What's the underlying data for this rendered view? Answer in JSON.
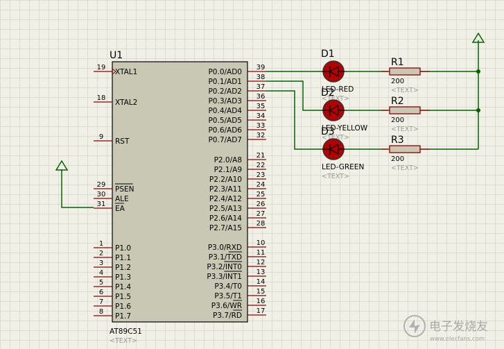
{
  "colors": {
    "background": "#f0f0e6",
    "grid": "#c9c9bd",
    "chip_fill": "#c8c8b4",
    "outline": "#000000",
    "pin_line": "#8b0000",
    "wire": "#006400",
    "led_fill": "#b40000",
    "resistor_fill": "#c8c8b4"
  },
  "chip": {
    "ref": "U1",
    "part": "AT89C51",
    "text_placeholder": "<TEXT>",
    "left_pins": [
      {
        "num": "19",
        "label": "XTAL1",
        "clock": true
      },
      {
        "num": "18",
        "label": "XTAL2"
      },
      {
        "num": "9",
        "label": "RST"
      },
      {
        "num": "29",
        "label": "PSEN",
        "overbar": true
      },
      {
        "num": "30",
        "label": "ALE"
      },
      {
        "num": "31",
        "label": "EA",
        "overbar": true
      },
      {
        "num": "1",
        "label": "P1.0"
      },
      {
        "num": "2",
        "label": "P1.1"
      },
      {
        "num": "3",
        "label": "P1.2"
      },
      {
        "num": "4",
        "label": "P1.3"
      },
      {
        "num": "5",
        "label": "P1.4"
      },
      {
        "num": "6",
        "label": "P1.5"
      },
      {
        "num": "7",
        "label": "P1.6"
      },
      {
        "num": "8",
        "label": "P1.7"
      }
    ],
    "right_pins": [
      {
        "num": "39",
        "label": "P0.0/AD0"
      },
      {
        "num": "38",
        "label": "P0.1/AD1"
      },
      {
        "num": "37",
        "label": "P0.2/AD2"
      },
      {
        "num": "36",
        "label": "P0.3/AD3"
      },
      {
        "num": "35",
        "label": "P0.4/AD4"
      },
      {
        "num": "34",
        "label": "P0.5/AD5"
      },
      {
        "num": "33",
        "label": "P0.6/AD6"
      },
      {
        "num": "32",
        "label": "P0.7/AD7"
      },
      {
        "num": "21",
        "label": "P2.0/A8"
      },
      {
        "num": "22",
        "label": "P2.1/A9"
      },
      {
        "num": "23",
        "label": "P2.2/A10"
      },
      {
        "num": "24",
        "label": "P2.3/A11"
      },
      {
        "num": "25",
        "label": "P2.4/A12"
      },
      {
        "num": "26",
        "label": "P2.5/A13"
      },
      {
        "num": "27",
        "label": "P2.6/A14"
      },
      {
        "num": "28",
        "label": "P2.7/A15"
      },
      {
        "num": "10",
        "label": "P3.0/RXD"
      },
      {
        "num": "11",
        "label": "P3.1/TXD",
        "bar_from": 5
      },
      {
        "num": "12",
        "label": "P3.2/INT0",
        "bar_from": 5
      },
      {
        "num": "13",
        "label": "P3.3/INT1",
        "bar_from": 5
      },
      {
        "num": "14",
        "label": "P3.4/T0"
      },
      {
        "num": "15",
        "label": "P3.5/T1"
      },
      {
        "num": "16",
        "label": "P3.6/WR",
        "bar_from": 5
      },
      {
        "num": "17",
        "label": "P3.7/RD",
        "bar_from": 5
      }
    ]
  },
  "leds": [
    {
      "ref": "D1",
      "name": "LED-RED",
      "placeholder": "<TEXT>"
    },
    {
      "ref": "D2",
      "name": "LED-YELLOW",
      "placeholder": "<TEXT>"
    },
    {
      "ref": "D3",
      "name": "LED-GREEN",
      "placeholder": "<TEXT>"
    }
  ],
  "resistors": [
    {
      "ref": "R1",
      "value": "200",
      "placeholder": "<TEXT>"
    },
    {
      "ref": "R2",
      "value": "200",
      "placeholder": "<TEXT>"
    },
    {
      "ref": "R3",
      "value": "200",
      "placeholder": "<TEXT>"
    }
  ],
  "watermark": {
    "text": "电子发烧友",
    "url": "www.elecfans.com"
  }
}
